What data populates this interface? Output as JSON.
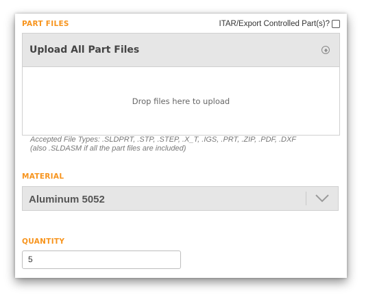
{
  "part_files": {
    "section_label": "PART FILES",
    "itar_label": "ITAR/Export Controlled Part(s)?",
    "itar_checked": false,
    "upload_title": "Upload All Part Files",
    "upload_icon": "upload-circle-icon",
    "drop_text": "Drop files here to upload",
    "accepted_types_line1": "Accepted File Types: .SLDPRT, .STP, .STEP, .X_T, .IGS, .PRT, .ZIP, .PDF, .DXF",
    "accepted_types_line2": "(also .SLDASM if all the part files are included)"
  },
  "material": {
    "section_label": "MATERIAL",
    "selected_value": "Aluminum 5052",
    "dropdown_icon": "chevron-down-icon"
  },
  "quantity": {
    "section_label": "QUANTITY",
    "value": "5"
  },
  "colors": {
    "accent": "#f7941d",
    "panel_gray": "#e6e6e6"
  }
}
